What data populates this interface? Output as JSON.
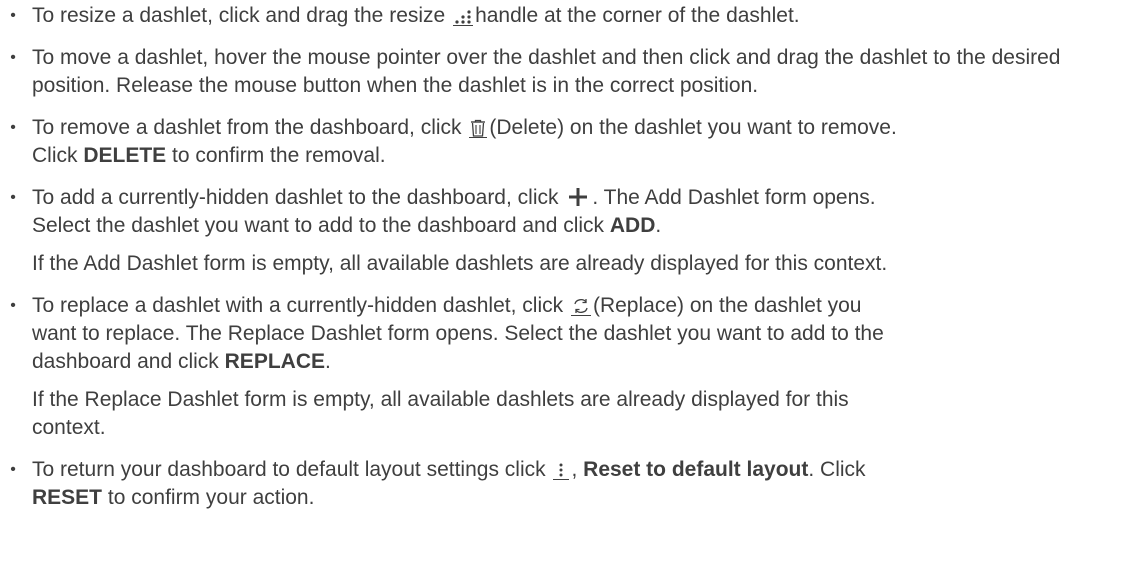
{
  "instructions": {
    "resize": {
      "before": "To resize a dashlet, click and drag the resize",
      "after": "handle at the corner of the dashlet."
    },
    "move": {
      "text": "To move a dashlet, hover the mouse pointer over the dashlet and then click and drag the dashlet to the desired position. Release the mouse button when the dashlet is in the correct position."
    },
    "remove": {
      "before": "To remove a dashlet from the dashboard, click",
      "after": "(Delete) on the dashlet you want to remove.",
      "line2_before": "Click",
      "line2_bold": "DELETE",
      "line2_after": "to confirm the removal."
    },
    "add": {
      "before": "To add a currently-hidden dashlet to the dashboard, click",
      "after": ". The Add Dashlet form opens.",
      "line2_before": "Select the dashlet you want to add to the dashboard and click",
      "line2_bold": "ADD",
      "line2_after": ".",
      "note": "If the Add Dashlet form is empty, all available dashlets are already displayed for this context."
    },
    "replace": {
      "before": "To replace a dashlet with a currently-hidden dashlet, click",
      "after": "(Replace) on the dashlet you",
      "line2": "want to replace. The Replace Dashlet form opens. Select the dashlet you want to add to the",
      "line3_before": "dashboard and click",
      "line3_bold": "REPLACE",
      "line3_after": ".",
      "note_line1": "If the Replace Dashlet form is empty, all available dashlets are already displayed for this",
      "note_line2": "context."
    },
    "reset": {
      "before": "To return your dashboard to default layout settings click",
      "comma": ",",
      "bold": "Reset to default layout",
      "after": ". Click",
      "line2_bold": "RESET",
      "line2_after": "to confirm your action."
    }
  },
  "icons": {
    "resize": "resize-handle-icon",
    "delete": "trash-icon",
    "add": "plus-icon",
    "replace": "replace-icon",
    "menu": "kebab-menu-icon"
  },
  "colors": {
    "text": "#3f3f3f"
  }
}
